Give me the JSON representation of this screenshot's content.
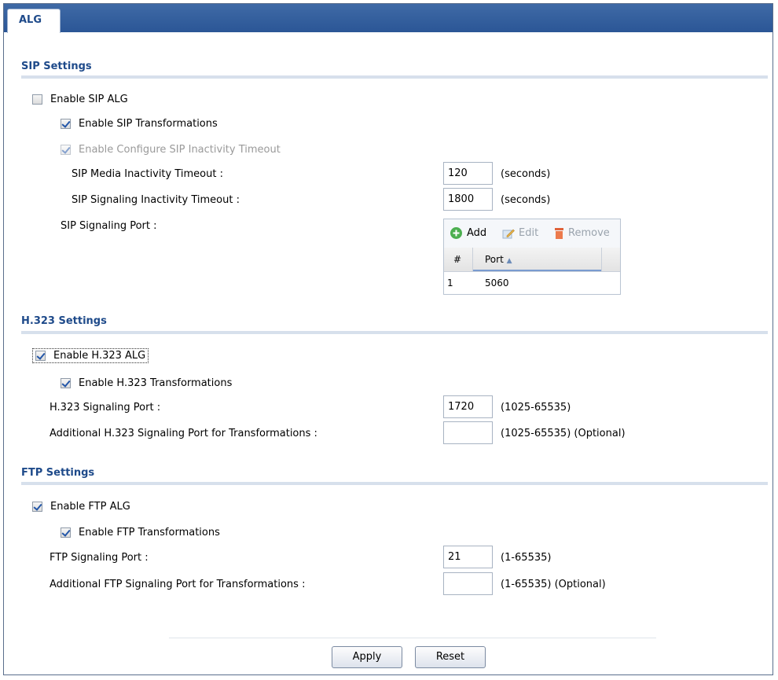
{
  "tab": {
    "label": "ALG"
  },
  "sip": {
    "section_title": "SIP Settings",
    "enable_label": "Enable SIP ALG",
    "transform_label": "Enable SIP Transformations",
    "inactivity_label": "Enable Configure SIP Inactivity Timeout",
    "media_timeout_label": "SIP Media Inactivity Timeout :",
    "media_timeout_value": "120",
    "media_timeout_unit": "(seconds)",
    "signal_timeout_label": "SIP Signaling Inactivity Timeout :",
    "signal_timeout_value": "1800",
    "signal_timeout_unit": "(seconds)",
    "port_label": "SIP Signaling Port :",
    "grid": {
      "add": "Add",
      "edit": "Edit",
      "remove": "Remove",
      "col_num": "#",
      "col_port": "Port",
      "rows": [
        {
          "num": "1",
          "port": "5060"
        }
      ]
    }
  },
  "h323": {
    "section_title": "H.323 Settings",
    "enable_label": "Enable H.323 ALG",
    "transform_label": "Enable H.323 Transformations",
    "port_label": "H.323 Signaling Port :",
    "port_value": "1720",
    "port_hint": "(1025-65535)",
    "add_port_label": "Additional H.323 Signaling Port for Transformations :",
    "add_port_value": "",
    "add_port_hint": "(1025-65535) (Optional)"
  },
  "ftp": {
    "section_title": "FTP Settings",
    "enable_label": "Enable FTP ALG",
    "transform_label": "Enable FTP Transformations",
    "port_label": "FTP Signaling Port :",
    "port_value": "21",
    "port_hint": "(1-65535)",
    "add_port_label": "Additional FTP Signaling Port for Transformations :",
    "add_port_value": "",
    "add_port_hint": "(1-65535) (Optional)"
  },
  "buttons": {
    "apply": "Apply",
    "reset": "Reset"
  },
  "colors": {
    "accent": "#1e4a8a",
    "tabbar": "#2b5696"
  },
  "icons": {
    "add": "plus-circle-icon",
    "edit": "edit-icon",
    "remove": "trash-icon",
    "sort": "sort-asc-icon"
  }
}
